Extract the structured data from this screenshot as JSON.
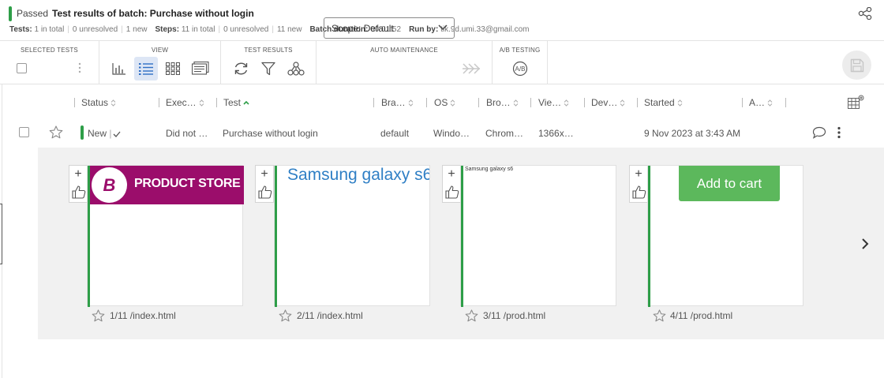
{
  "header": {
    "status": "Passed",
    "title": "Test results of batch:  Purchase without login",
    "stats": {
      "tests_label": "Tests:",
      "tests_total": "1 in total",
      "tests_unresolved": "0 unresolved",
      "tests_new": "1 new",
      "steps_label": "Steps:",
      "steps_total": "11 in total",
      "steps_unresolved": "0 unresolved",
      "steps_new": "11 new",
      "duration_label": "Batch duration:",
      "duration_value": "00:01:52",
      "runby_label": "Run by:",
      "runby_value": "tik.9d.umi.33@gmail.com"
    }
  },
  "toolbar": {
    "selected_tests_label": "SELECTED TESTS",
    "view_label": "VIEW",
    "test_results_label": "TEST RESULTS",
    "auto_maintenance_label": "AUTO MAINTENANCE",
    "ab_testing_label": "A/B TESTING",
    "scope_value": "Scope: Default"
  },
  "columns": [
    "Status",
    "Exec…",
    "Test",
    "Bra…",
    "OS",
    "Bro…",
    "Vie…",
    "Dev…",
    "Started",
    "A…"
  ],
  "row": {
    "status": "New",
    "execution": "Did not …",
    "test": "Purchase without login",
    "branch": "default",
    "os": "Windo…",
    "browser": "Chrom…",
    "viewport": "1366x…",
    "started": "9 Nov 2023 at 3:43 AM"
  },
  "thumbnails": [
    {
      "caption": "1/11 /index.html",
      "banner_logo": "B",
      "banner_text": "PRODUCT STORE"
    },
    {
      "caption": "2/11 /index.html",
      "text": "Samsung galaxy s6"
    },
    {
      "caption": "3/11 /prod.html",
      "text": "Samsung galaxy s6"
    },
    {
      "caption": "4/11 /prod.html",
      "button": "Add to cart"
    }
  ],
  "colors": {
    "passed": "#2e9e48",
    "product_banner": "#9b0d6b",
    "add_to_cart": "#5cb85c",
    "link_blue": "#2f7fc5"
  }
}
